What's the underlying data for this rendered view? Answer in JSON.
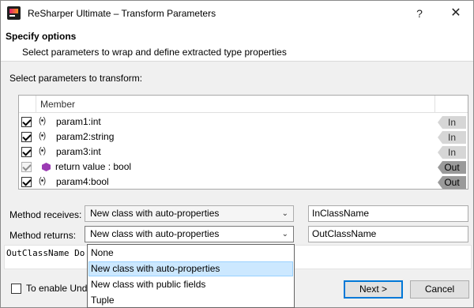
{
  "window": {
    "title": "ReSharper Ultimate – Transform Parameters",
    "help_label": "?",
    "close_label": "✕"
  },
  "header": {
    "title": "Specify options",
    "subtitle": "Select parameters to wrap and define extracted type properties"
  },
  "params_section": {
    "label": "Select parameters to transform:",
    "column_member": "Member",
    "rows": [
      {
        "name": "param1:int",
        "checked": true,
        "disabled": false,
        "icon": "parameter-icon",
        "direction": "In"
      },
      {
        "name": "param2:string",
        "checked": true,
        "disabled": false,
        "icon": "parameter-icon",
        "direction": "In"
      },
      {
        "name": "param3:int",
        "checked": true,
        "disabled": false,
        "icon": "parameter-icon",
        "direction": "In"
      },
      {
        "name": "return value : bool",
        "checked": true,
        "disabled": true,
        "icon": "return-value-icon",
        "direction": "Out"
      },
      {
        "name": "param4:bool",
        "checked": true,
        "disabled": false,
        "icon": "parameter-icon",
        "direction": "Out"
      }
    ],
    "param_glyph": "(•)"
  },
  "method_receives": {
    "label": "Method receives:",
    "value": "New class with auto-properties",
    "class_name": "InClassName"
  },
  "method_returns": {
    "label": "Method returns:",
    "value": "New class with auto-properties",
    "class_name": "OutClassName"
  },
  "preview_text": "OutClassName Do",
  "dropdown_options": [
    {
      "label": "None",
      "selected": false
    },
    {
      "label": "New class with auto-properties",
      "selected": true
    },
    {
      "label": "New class with public fields",
      "selected": false
    },
    {
      "label": "Tuple",
      "selected": false
    }
  ],
  "footer": {
    "undo_label": "To enable Undo",
    "next_label": "Next >",
    "cancel_label": "Cancel"
  },
  "colors": {
    "selection_bg": "#cce8ff",
    "default_button_border": "#0078d7",
    "return_icon": "#9b3bb3"
  }
}
